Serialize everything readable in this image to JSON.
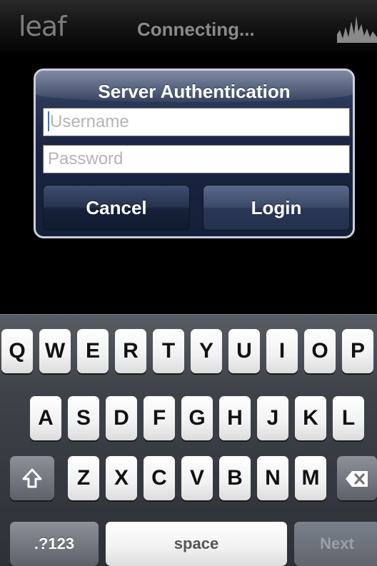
{
  "app": {
    "logo_text": "leaf",
    "status_title": "Connecting..."
  },
  "dialog": {
    "title": "Server Authentication",
    "username_placeholder": "Username",
    "password_placeholder": "Password",
    "cancel_label": "Cancel",
    "login_label": "Login"
  },
  "keyboard": {
    "row1": [
      "Q",
      "W",
      "E",
      "R",
      "T",
      "Y",
      "U",
      "I",
      "O",
      "P"
    ],
    "row2": [
      "A",
      "S",
      "D",
      "F",
      "G",
      "H",
      "J",
      "K",
      "L"
    ],
    "row3": [
      "Z",
      "X",
      "C",
      "V",
      "B",
      "N",
      "M"
    ],
    "numbers_label": ".?123",
    "space_label": "space",
    "next_label": "Next",
    "shift_icon": "shift-arrow-icon",
    "delete_icon": "delete-icon"
  },
  "icons": {
    "histogram": "histogram-icon"
  }
}
